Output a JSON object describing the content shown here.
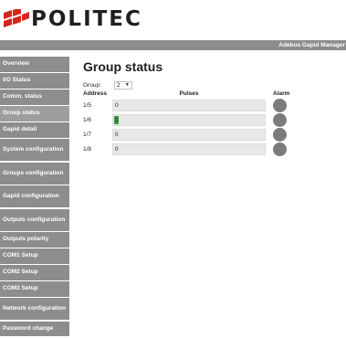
{
  "brand": {
    "logo_text": "POLITEC"
  },
  "topbar": {
    "product_label": "Adebus Gapid Manager"
  },
  "sidebar": {
    "items": [
      {
        "label": "Overview",
        "active": false
      },
      {
        "label": "I/O Status",
        "active": false
      },
      {
        "label": "Comm. status",
        "active": false
      },
      {
        "label": "Group status",
        "active": true
      },
      {
        "label": "Gapid detail",
        "active": false
      },
      {
        "label": "System configuration",
        "active": false
      },
      {
        "label": "Groups configuration",
        "active": false
      },
      {
        "label": "Gapid configuration",
        "active": false
      },
      {
        "label": "Outputs configuration",
        "active": false
      },
      {
        "label": "Outputs polarity",
        "active": false
      },
      {
        "label": "COM1 Setup",
        "active": false
      },
      {
        "label": "COM2 Setup",
        "active": false
      },
      {
        "label": "COM3 Setup",
        "active": false
      },
      {
        "label": "Network configuration",
        "active": false
      },
      {
        "label": "Password change",
        "active": false
      }
    ]
  },
  "main": {
    "title": "Group status",
    "group_label": "Group:",
    "group_value": "2",
    "columns": {
      "address": "Address",
      "pulses": "Pulses",
      "alarm": "Alarm"
    },
    "rows": [
      {
        "address": "1/5",
        "pulses": "0",
        "level": 0
      },
      {
        "address": "1/6",
        "pulses": "1",
        "level": 0.03
      },
      {
        "address": "1/7",
        "pulses": "0",
        "level": 0
      },
      {
        "address": "1/8",
        "pulses": "0",
        "level": 0
      }
    ]
  },
  "colors": {
    "nav_bg": "#8d8d8d",
    "nav_active_bg": "#9e9e9e",
    "pulse_fill": "#3f9a3f",
    "alarm_off": "#7b7b7b"
  },
  "icons": {
    "logo_mark": "politec-logo-mark",
    "select_arrow": "chevron-down-icon",
    "alarm": "alarm-lamp-icon"
  }
}
